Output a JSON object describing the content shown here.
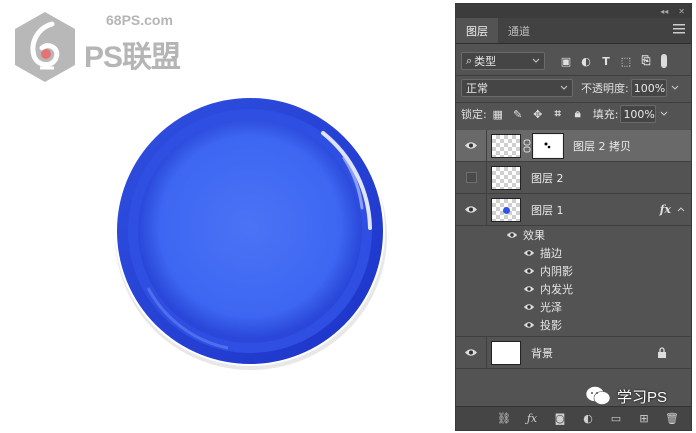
{
  "watermark": {
    "site": "68PS.com",
    "brand": "PS联盟",
    "bottom_brand": "学习PS"
  },
  "panel": {
    "tabs": [
      {
        "label": "图层",
        "active": true
      },
      {
        "label": "通道",
        "active": false
      }
    ],
    "filter": {
      "label": "类型"
    },
    "blend_mode": "正常",
    "opacity_label": "不透明度:",
    "opacity_value": "100%",
    "lock_label": "锁定:",
    "fill_label": "填充:",
    "fill_value": "100%",
    "layers": [
      {
        "name": "图层 2 拷贝",
        "visible": true,
        "selected": true,
        "has_mask": true
      },
      {
        "name": "图层 2",
        "visible": false,
        "selected": false
      },
      {
        "name": "图层 1",
        "visible": true,
        "selected": false,
        "fx": "fx"
      },
      {
        "name": "背景",
        "visible": true,
        "selected": false,
        "locked": true
      }
    ],
    "effects_label": "效果",
    "effects": [
      "描边",
      "内阴影",
      "内发光",
      "光泽",
      "投影"
    ]
  },
  "colors": {
    "button_blue": "#3157e8",
    "panel_bg": "#535353"
  }
}
